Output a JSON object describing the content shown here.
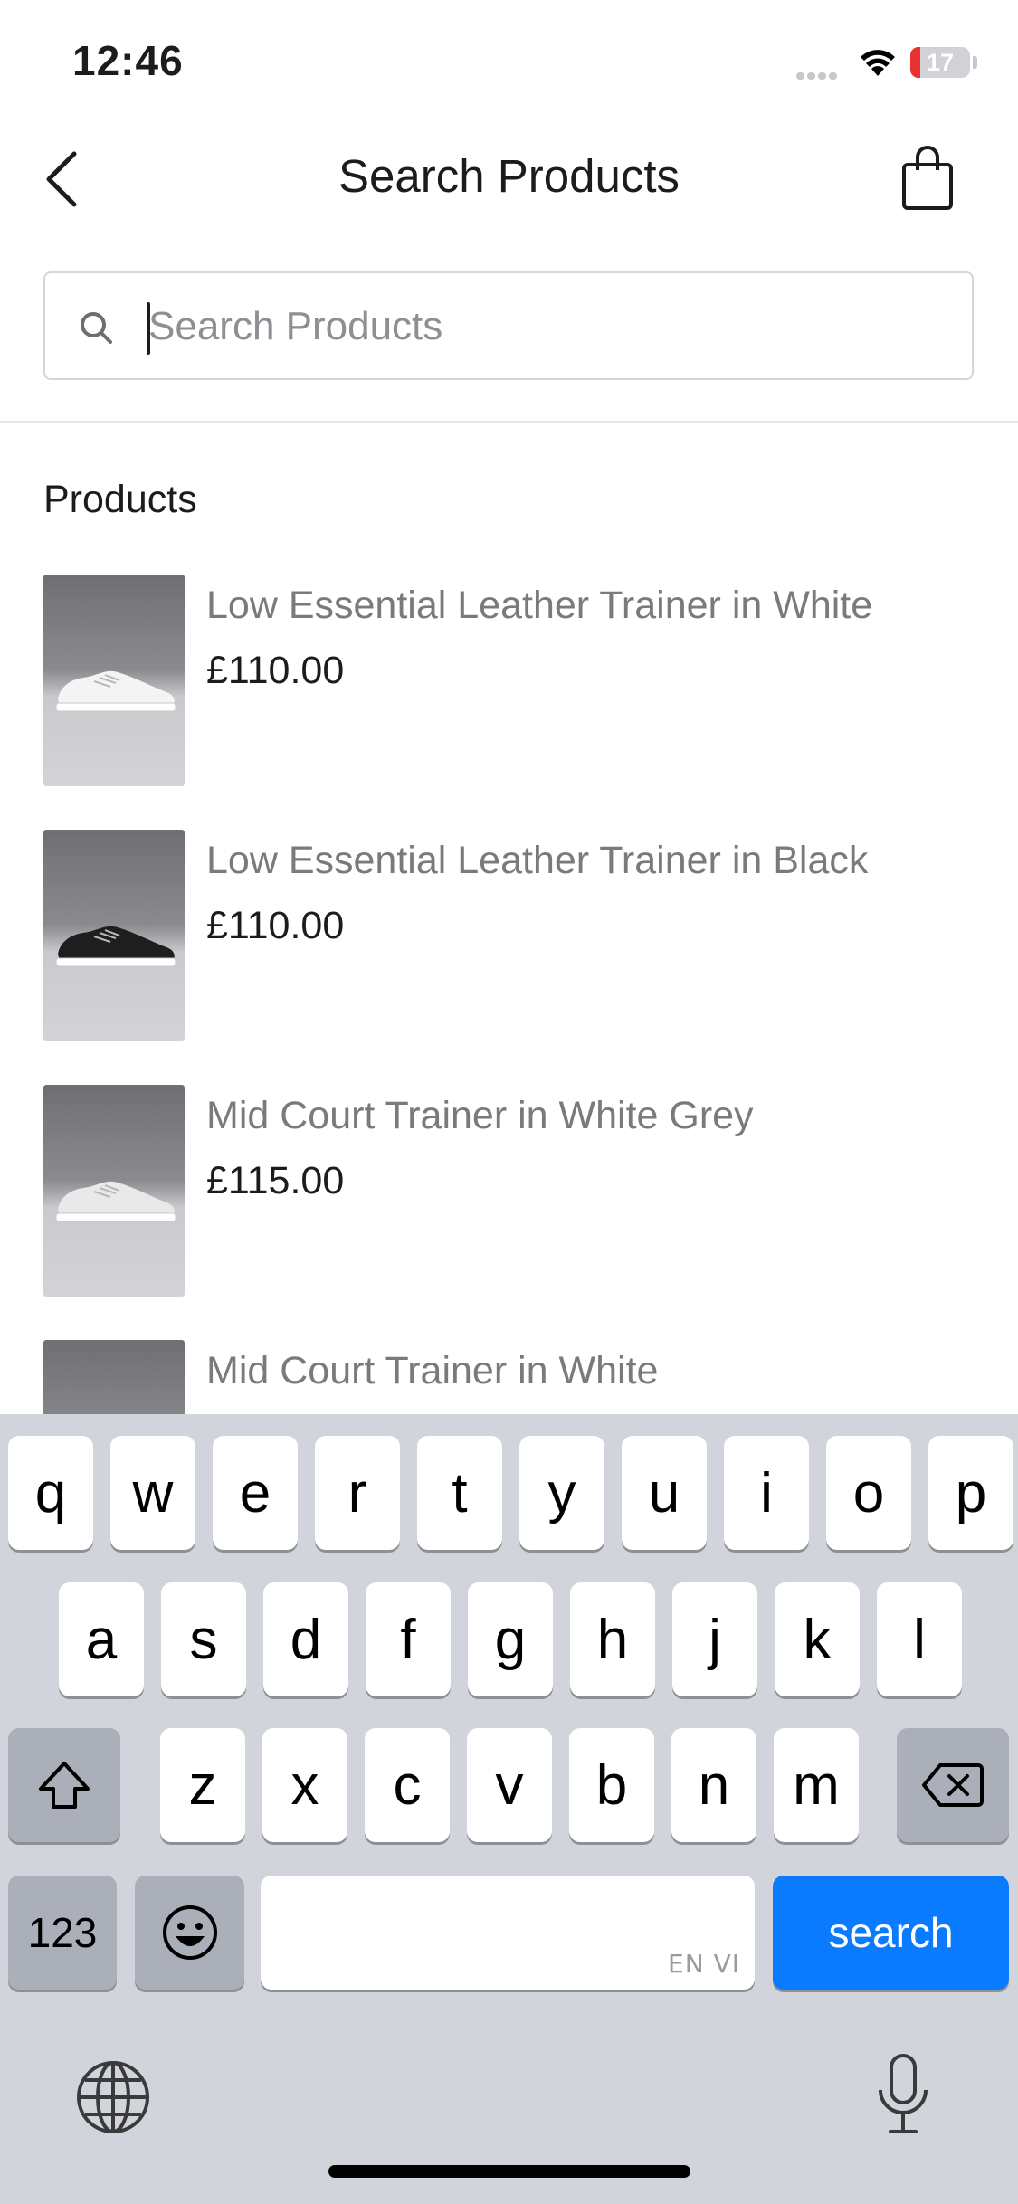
{
  "status_bar": {
    "time": "12:46",
    "battery": "17",
    "battery_level": 0.17
  },
  "header": {
    "title": "Search Products",
    "back_icon": "chevron-left-icon",
    "bag_icon": "shopping-bag-icon"
  },
  "search": {
    "placeholder": "Search Products",
    "value": ""
  },
  "section": {
    "title": "Products"
  },
  "products": [
    {
      "name": "Low Essential Leather Trainer in White",
      "price": "£110.00",
      "shoe_color": "#f4f4f4"
    },
    {
      "name": "Low Essential Leather Trainer in Black",
      "price": "£110.00",
      "shoe_color": "#1e1e1f"
    },
    {
      "name": "Mid Court Trainer in White Grey",
      "price": "£115.00",
      "shoe_color": "#e9e9ea"
    },
    {
      "name": "Mid Court Trainer in White",
      "price": "",
      "shoe_color": "#f4f4f4"
    }
  ],
  "keyboard": {
    "row1": [
      "q",
      "w",
      "e",
      "r",
      "t",
      "y",
      "u",
      "i",
      "o",
      "p"
    ],
    "row2": [
      "a",
      "s",
      "d",
      "f",
      "g",
      "h",
      "j",
      "k",
      "l"
    ],
    "row3": [
      "z",
      "x",
      "c",
      "v",
      "b",
      "n",
      "m"
    ],
    "numbers_key": "123",
    "search_key": "search",
    "space_lang": "EN VI",
    "shift_icon": "shift-icon",
    "delete_icon": "delete-icon",
    "emoji_icon": "emoji-icon",
    "globe_icon": "globe-icon",
    "mic_icon": "microphone-icon",
    "accent": "#0a7aff"
  }
}
